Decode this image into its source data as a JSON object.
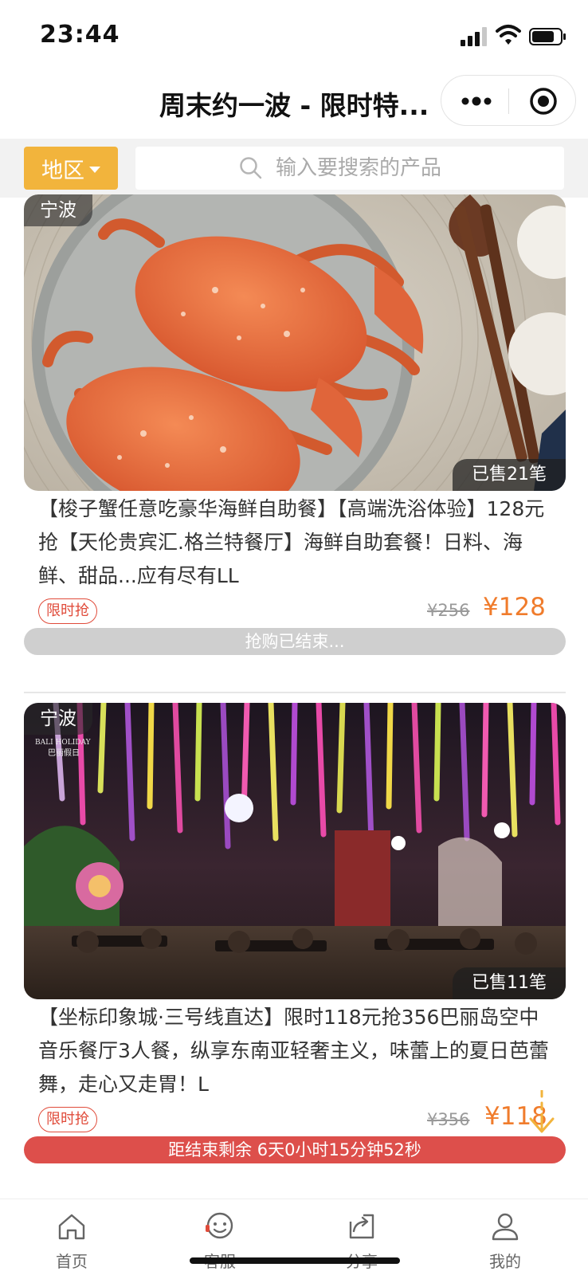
{
  "status_bar": {
    "time": "23:44"
  },
  "header": {
    "title": "周末约一波 - 限时特..."
  },
  "search": {
    "region_label": "地区",
    "placeholder": "输入要搜索的产品"
  },
  "products": [
    {
      "region": "宁波",
      "sold": "已售21笔",
      "title": "【梭子蟹任意吃豪华海鲜自助餐】【高端洗浴体验】128元抢【天伦贵宾汇.格兰特餐厅】海鲜自助套餐！日料、海鲜、甜品...应有尽有LL",
      "badge": "限时抢",
      "old_price": "¥256",
      "price": "¥128",
      "status": "抢购已结束..."
    },
    {
      "region": "宁波",
      "sold": "已售11笔",
      "title": "【坐标印象城·三号线直达】限时118元抢356巴丽岛空中音乐餐厅3人餐，纵享东南亚轻奢主义，味蕾上的夏日芭蕾舞，走心又走胃！L",
      "badge": "限时抢",
      "old_price": "¥356",
      "price": "¥118",
      "status": "距结束剩余 6天0小时15分钟52秒"
    }
  ],
  "image_text": {
    "logo_line1": "BALI HOLIDAY",
    "logo_line2": "巴丽假日"
  },
  "tabbar": [
    {
      "label": "首页",
      "icon": "home-icon"
    },
    {
      "label": "客服",
      "icon": "customer-service-icon"
    },
    {
      "label": "分享",
      "icon": "share-icon"
    },
    {
      "label": "我的",
      "icon": "user-icon"
    }
  ],
  "colors": {
    "accent": "#f2b43c",
    "price": "#f07c2c",
    "badge": "#e04b3a",
    "countdown": "#dd4f4b",
    "ended": "#cfcfcf"
  }
}
